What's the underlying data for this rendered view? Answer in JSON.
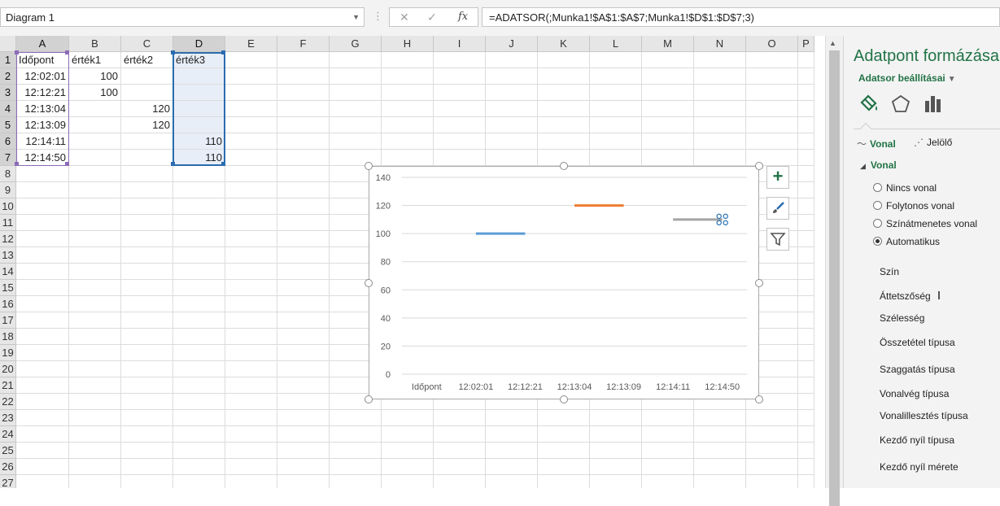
{
  "formula_bar": {
    "name_box": "Diagram 1",
    "separator": "⋮",
    "cancel_glyph": "✕",
    "enter_glyph": "✓",
    "fx_glyph": "fx",
    "formula": "=ADATSOR(;Munka1!$A$1:$A$7;Munka1!$D$1:$D$7;3)"
  },
  "sheet": {
    "columns": [
      {
        "label": "A",
        "selected": true
      },
      {
        "label": "B",
        "selected": false
      },
      {
        "label": "C",
        "selected": false
      },
      {
        "label": "D",
        "selected": true
      },
      {
        "label": "E",
        "selected": false
      },
      {
        "label": "F",
        "selected": false
      },
      {
        "label": "G",
        "selected": false
      },
      {
        "label": "H",
        "selected": false
      },
      {
        "label": "I",
        "selected": false
      },
      {
        "label": "J",
        "selected": false
      },
      {
        "label": "K",
        "selected": false
      },
      {
        "label": "L",
        "selected": false
      },
      {
        "label": "M",
        "selected": false
      },
      {
        "label": "N",
        "selected": false
      },
      {
        "label": "O",
        "selected": false
      },
      {
        "label": "P",
        "selected": false
      }
    ],
    "rows": [
      "1",
      "2",
      "3",
      "4",
      "5",
      "6",
      "7",
      "8",
      "9",
      "10",
      "11",
      "12",
      "13",
      "14",
      "15",
      "16",
      "17",
      "18",
      "19",
      "20",
      "21",
      "22",
      "23",
      "24",
      "25",
      "26",
      "27"
    ],
    "selected_rows": 7,
    "cells": [
      [
        "Időpont",
        "érték1",
        "érték2",
        "érték3"
      ],
      [
        "12:02:01",
        "100",
        "",
        ""
      ],
      [
        "12:12:21",
        "100",
        "",
        ""
      ],
      [
        "12:13:04",
        "",
        "120",
        ""
      ],
      [
        "12:13:09",
        "",
        "120",
        ""
      ],
      [
        "12:14:11",
        "",
        "",
        "110"
      ],
      [
        "12:14:50",
        "",
        "",
        "110"
      ]
    ],
    "range_colors": {
      "a_column": "#8c6bb8",
      "d_column": "#2b6cb0"
    }
  },
  "chart_data": {
    "type": "line",
    "categories": [
      "Időpont",
      "12:02:01",
      "12:12:21",
      "12:13:04",
      "12:13:09",
      "12:14:11",
      "12:14:50"
    ],
    "series": [
      {
        "color": "#5b9bd5",
        "values": [
          null,
          100,
          100,
          null,
          null,
          null,
          null
        ]
      },
      {
        "color": "#ed7d31",
        "values": [
          null,
          null,
          null,
          120,
          120,
          null,
          null
        ]
      },
      {
        "color": "#a5a5a5",
        "values": [
          null,
          null,
          null,
          null,
          null,
          110,
          110
        ]
      }
    ],
    "yticks": [
      "0",
      "20",
      "40",
      "60",
      "80",
      "100",
      "120",
      "140"
    ],
    "ylim": [
      0,
      140
    ],
    "grid": true,
    "title": "",
    "xlabel": "",
    "ylabel": ""
  },
  "chart_buttons": [
    {
      "name": "chart-elements-button",
      "glyph": "+",
      "color": "#217346"
    },
    {
      "name": "chart-styles-button",
      "glyph": "brush",
      "color": "#2b6cb0"
    },
    {
      "name": "chart-filters-button",
      "glyph": "funnel",
      "color": "#555555"
    }
  ],
  "pane": {
    "title": "Adatpont formázása",
    "subtitle": "Adatsor beállításai",
    "caret": "▼",
    "tabs": [
      "paint-bucket",
      "pentagon",
      "bar-chart"
    ],
    "subtabs": [
      {
        "label": "Vonal",
        "active": true,
        "icon": "〜"
      },
      {
        "label": "Jelölő",
        "active": false,
        "icon": "⋰"
      }
    ],
    "section": "Vonal",
    "section_tri": "◢",
    "radios": [
      {
        "label": "Nincs vonal",
        "checked": false
      },
      {
        "label": "Folytonos vonal",
        "checked": false
      },
      {
        "label": "Színátmenetes vonal",
        "checked": false
      },
      {
        "label": "Automatikus",
        "checked": true
      }
    ],
    "properties": [
      "Szín",
      "Áttetszőség",
      "Szélesség",
      "Összetétel típusa",
      "Szaggatás típusa",
      "Vonalvég típusa",
      "Vonalillesztés típusa",
      "Kezdő nyíl típusa",
      "Kezdő nyíl mérete"
    ]
  },
  "colors": {
    "accent": "#217346"
  }
}
